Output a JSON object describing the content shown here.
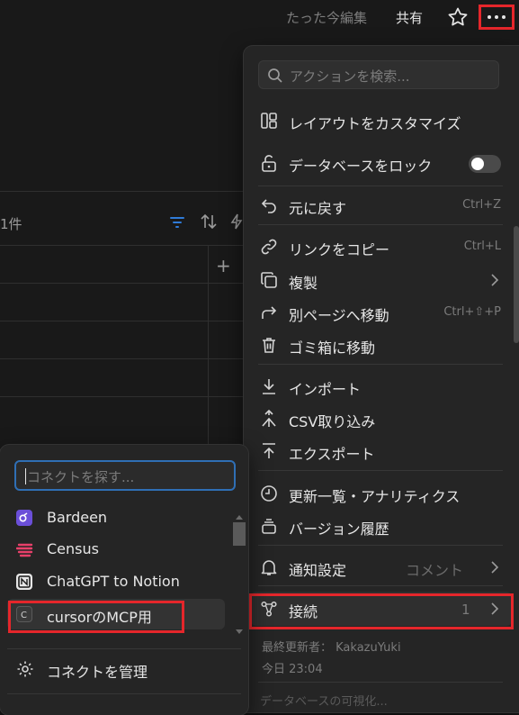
{
  "topbar": {
    "edited_label": "たった今編集",
    "share_label": "共有",
    "star_icon": "star-icon",
    "more_icon": "more-horizontal-icon"
  },
  "database": {
    "count_label": "1件",
    "add_label": "+"
  },
  "menu": {
    "search_placeholder": "アクションを検索...",
    "items": [
      {
        "label": "レイアウトをカスタマイズ",
        "icon": "layout-icon"
      },
      {
        "label": "データベースをロック",
        "icon": "unlock-icon",
        "toggle_on": false
      },
      {
        "label": "元に戻す",
        "icon": "undo-icon",
        "shortcut": "Ctrl+Z"
      },
      {
        "label": "リンクをコピー",
        "icon": "link-icon",
        "shortcut": "Ctrl+L"
      },
      {
        "label": "複製",
        "icon": "duplicate-icon",
        "has_submenu": true
      },
      {
        "label": "別ページへ移動",
        "icon": "move-arrow-icon",
        "shortcut": "Ctrl+⇧+P"
      },
      {
        "label": "ゴミ箱に移動",
        "icon": "trash-icon"
      },
      {
        "label": "インポート",
        "icon": "import-icon"
      },
      {
        "label": "CSV取り込み",
        "icon": "csv-merge-icon"
      },
      {
        "label": "エクスポート",
        "icon": "export-icon"
      },
      {
        "label": "更新一覧・アナリティクス",
        "icon": "clock-icon"
      },
      {
        "label": "バージョン履歴",
        "icon": "version-history-icon"
      },
      {
        "label": "通知設定",
        "icon": "bell-icon",
        "sub": "コメント",
        "has_submenu": true
      },
      {
        "label": "接続",
        "icon": "connections-icon",
        "count": "1",
        "has_submenu": true
      }
    ],
    "last_updated_by": "最終更新者： KakazuYuki",
    "last_updated_time": "今日 23:04",
    "cut_off_text": "データベースの可視化..."
  },
  "connect_menu": {
    "search_placeholder": "コネクトを探す...",
    "items": [
      {
        "label": "Bardeen",
        "color": "#6b4fd8"
      },
      {
        "label": "Census",
        "color": "#e8406a"
      },
      {
        "label": "ChatGPT to Notion",
        "color": "#e6e6e6"
      },
      {
        "label": "cursorのMCP用",
        "color": "#3a3a3a"
      }
    ],
    "manage_label": "コネクトを管理"
  },
  "colors": {
    "highlight_red": "#e5262b",
    "focus_blue": "#2f6fb5",
    "filter_blue": "#2f7bd8"
  }
}
